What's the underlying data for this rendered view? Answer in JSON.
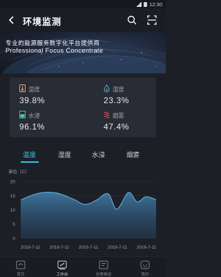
{
  "status_bar": {
    "time": "12:30"
  },
  "header": {
    "title": "环境监测",
    "back_icon": "back-arrow-icon",
    "search_icon": "search-icon",
    "scan_icon": "scan-icon"
  },
  "banner": {
    "line1": "专业的能源服务数字化平台提供商",
    "line2": "Professional Focus Concentrate"
  },
  "metrics": [
    {
      "label": "温度",
      "value": "39.8%",
      "icon": "thermometer-icon",
      "color": "#f0b27a"
    },
    {
      "label": "湿度",
      "value": "23.3%",
      "icon": "water-drop-icon",
      "color": "#5bc0de"
    },
    {
      "label": "水浸",
      "value": "96.1%",
      "icon": "water-immersion-icon",
      "color": "#3fd1b0"
    },
    {
      "label": "烟雾",
      "value": "47.4%",
      "icon": "smoke-icon",
      "color": "#e2575b"
    }
  ],
  "tabs": [
    {
      "label": "温度",
      "active": true
    },
    {
      "label": "湿度",
      "active": false
    },
    {
      "label": "水浸",
      "active": false
    },
    {
      "label": "烟雾",
      "active": false
    }
  ],
  "chart_data": {
    "type": "area",
    "ylabel": "单位（C）",
    "ylim": [
      0,
      20
    ],
    "yticks": [
      0,
      5,
      10,
      15,
      20
    ],
    "x_labels": [
      "2018-7-11",
      "2018-7-11",
      "2018-7-11",
      "2018-7-11",
      "2018-7-11"
    ],
    "x": [
      0,
      0.6,
      1.2,
      1.8,
      2.2,
      2.6,
      3.0,
      3.3,
      3.7,
      4.0,
      4.3,
      4.65
    ],
    "series": [
      {
        "values": [
          13.5,
          15.8,
          16.0,
          13.8,
          11.9,
          13.4,
          15.7,
          10.2,
          16.1,
          12.8,
          14.6,
          13.6
        ],
        "color": "#5aa9d4"
      }
    ],
    "grid": true
  },
  "tabbar": [
    {
      "label": "首页",
      "icon": "home-icon",
      "active": false
    },
    {
      "label": "工作台",
      "icon": "workbench-icon",
      "active": true
    },
    {
      "label": "告警推送",
      "icon": "alarm-message-icon",
      "active": false
    },
    {
      "label": "我的",
      "icon": "profile-icon",
      "active": false
    }
  ]
}
